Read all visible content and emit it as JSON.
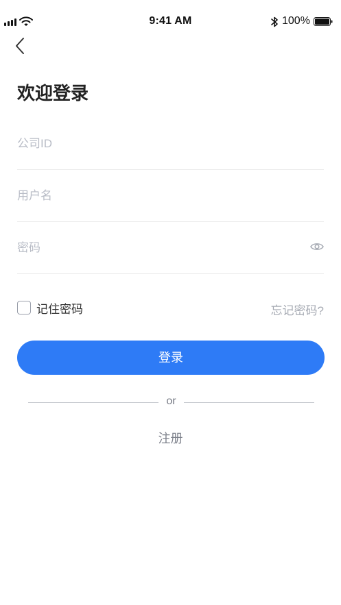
{
  "status_bar": {
    "time": "9:41 AM",
    "battery": "100%",
    "icons": [
      "signal-icon",
      "wifi-icon",
      "bluetooth-icon",
      "battery-icon"
    ]
  },
  "nav": {
    "back_icon": "chevron-left-icon"
  },
  "page": {
    "title": "欢迎登录"
  },
  "form": {
    "company_placeholder": "公司ID",
    "company_value": "",
    "username_placeholder": "用户名",
    "username_value": "",
    "password_placeholder": "密码",
    "password_value": "",
    "password_toggle_icon": "eye-icon",
    "remember_label": "记住密码",
    "remember_checked": false,
    "forgot_label": "忘记密码?"
  },
  "actions": {
    "login_label": "登录",
    "divider_text": "or",
    "register_label": "注册"
  },
  "colors": {
    "primary": "#2e7bf6",
    "placeholder": "#b8bcc6",
    "muted": "#a6aab3"
  }
}
